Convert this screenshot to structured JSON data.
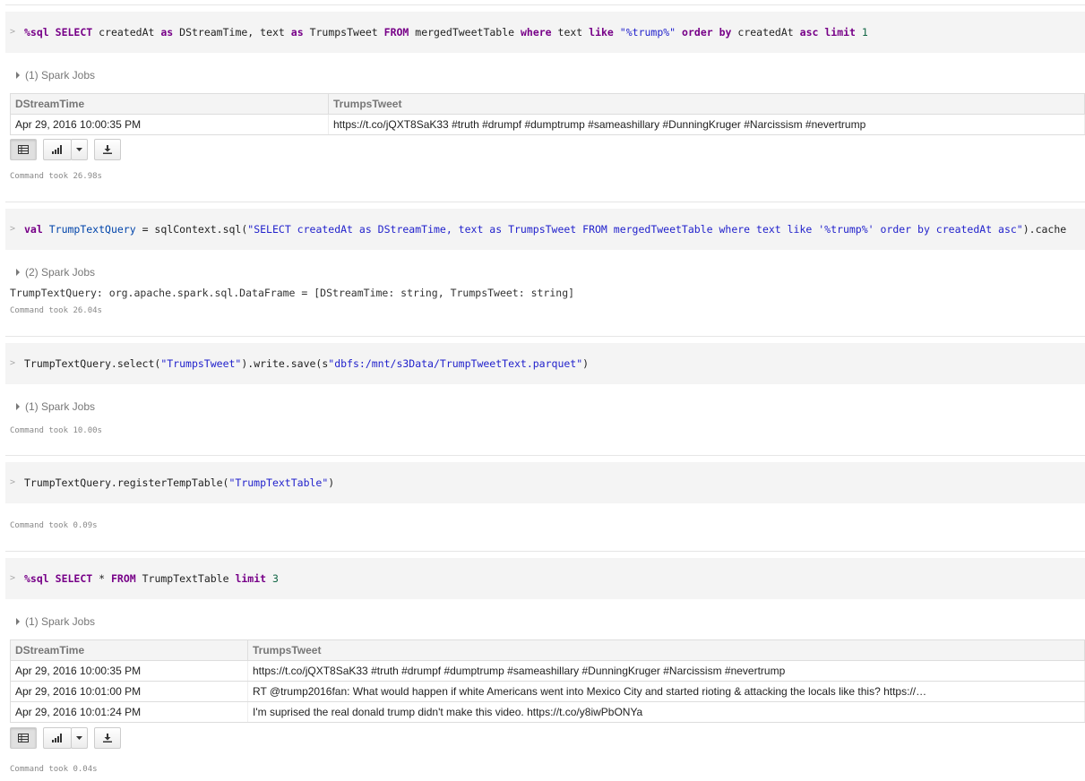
{
  "cells": [
    {
      "gt": ">",
      "code": [
        {
          "t": "%sql",
          "c": "kw"
        },
        {
          "t": " "
        },
        {
          "t": "SELECT",
          "c": "kw"
        },
        {
          "t": " createdAt "
        },
        {
          "t": "as",
          "c": "kw"
        },
        {
          "t": " DStreamTime, text "
        },
        {
          "t": "as",
          "c": "kw"
        },
        {
          "t": " TrumpsTweet "
        },
        {
          "t": "FROM",
          "c": "kw"
        },
        {
          "t": " mergedTweetTable "
        },
        {
          "t": "where",
          "c": "kw"
        },
        {
          "t": " text "
        },
        {
          "t": "like",
          "c": "kw"
        },
        {
          "t": " "
        },
        {
          "t": "\"%trump%\"",
          "c": "str"
        },
        {
          "t": " "
        },
        {
          "t": "order",
          "c": "kw"
        },
        {
          "t": " "
        },
        {
          "t": "by",
          "c": "kw"
        },
        {
          "t": " createdAt "
        },
        {
          "t": "asc",
          "c": "kw"
        },
        {
          "t": " "
        },
        {
          "t": "limit",
          "c": "kw"
        },
        {
          "t": " "
        },
        {
          "t": "1",
          "c": "num"
        }
      ],
      "jobs": "(1) Spark Jobs",
      "table": {
        "headers": [
          "DStreamTime",
          "TrumpsTweet"
        ],
        "rows": [
          [
            "Apr 29, 2016 10:00:35 PM",
            "https://t.co/jQXT8SaK33 #truth #drumpf #dumptrump #sameashillary #DunningKruger #Narcissism #nevertrump"
          ]
        ]
      },
      "took": "Command took 26.98s"
    },
    {
      "gt": ">",
      "code": [
        {
          "t": "val",
          "c": "kw"
        },
        {
          "t": " "
        },
        {
          "t": "TrumpTextQuery",
          "c": "def"
        },
        {
          "t": " = sqlContext.sql("
        },
        {
          "t": "\"SELECT createdAt as DStreamTime, text as TrumpsTweet FROM mergedTweetTable where text like '%trump%' order by createdAt asc\"",
          "c": "str"
        },
        {
          "t": ").cache"
        }
      ],
      "jobs": "(2) Spark Jobs",
      "result": "TrumpTextQuery: org.apache.spark.sql.DataFrame = [DStreamTime: string, TrumpsTweet: string]",
      "took": "Command took 26.04s"
    },
    {
      "gt": ">",
      "code": [
        {
          "t": "TrumpTextQuery.select("
        },
        {
          "t": "\"TrumpsTweet\"",
          "c": "str"
        },
        {
          "t": ").write.save(s"
        },
        {
          "t": "\"dbfs:/mnt/s3Data/TrumpTweetText.parquet\"",
          "c": "str"
        },
        {
          "t": ")"
        }
      ],
      "jobs": "(1) Spark Jobs",
      "took": "Command took 10.00s"
    },
    {
      "gt": ">",
      "code": [
        {
          "t": "TrumpTextQuery.registerTempTable("
        },
        {
          "t": "\"TrumpTextTable\"",
          "c": "str"
        },
        {
          "t": ")"
        }
      ],
      "took": "Command took 0.09s"
    },
    {
      "gt": ">",
      "code": [
        {
          "t": "%sql",
          "c": "kw"
        },
        {
          "t": " "
        },
        {
          "t": "SELECT",
          "c": "kw"
        },
        {
          "t": " * "
        },
        {
          "t": "FROM",
          "c": "kw"
        },
        {
          "t": " TrumpTextTable "
        },
        {
          "t": "limit",
          "c": "kw"
        },
        {
          "t": " "
        },
        {
          "t": "3",
          "c": "num"
        }
      ],
      "jobs": "(1) Spark Jobs",
      "table": {
        "headers": [
          "DStreamTime",
          "TrumpsTweet"
        ],
        "rows": [
          [
            "Apr 29, 2016 10:00:35 PM",
            "https://t.co/jQXT8SaK33 #truth #drumpf #dumptrump #sameashillary #DunningKruger #Narcissism #nevertrump"
          ],
          [
            "Apr 29, 2016 10:01:00 PM",
            "RT @trump2016fan: What would happen if white Americans went into Mexico City and started rioting & attacking the locals like this? https://…"
          ],
          [
            "Apr 29, 2016 10:01:24 PM",
            "I'm suprised the real donald trump didn't make this video. https://t.co/y8iwPbONYa"
          ]
        ]
      },
      "took": "Command took 0.04s"
    }
  ],
  "toolbar": {
    "icons": [
      "table-icon",
      "bar-chart-icon",
      "chevron-down-icon",
      "download-icon"
    ]
  }
}
